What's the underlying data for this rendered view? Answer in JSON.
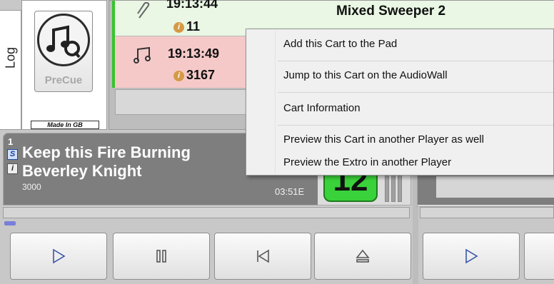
{
  "log_tab": {
    "label": "Log"
  },
  "precue": {
    "label": "PreCue",
    "badge": "Made In GB"
  },
  "log_rows": [
    {
      "time": "19:13:44",
      "info_num": "11",
      "title": "Mixed Sweeper 2"
    },
    {
      "time": "19:13:49",
      "info_num": "3167"
    }
  ],
  "player": {
    "slot": "1",
    "s_button": "S",
    "i_button": "i",
    "title": "Keep this Fire Burning",
    "artist": "Beverley Knight",
    "cart": "3000",
    "duration": "03:51E",
    "counter": "12"
  },
  "context_menu": {
    "items": [
      "Add this Cart to the Pad",
      "Jump to this Cart on the AudioWall",
      "Cart Information",
      "Preview this Cart in another Player as well",
      "Preview the Extro in another Player"
    ]
  },
  "transport": [
    "play-icon",
    "pause-icon",
    "skip-back-icon",
    "eject-icon",
    "play-icon"
  ],
  "colors": {
    "accent_green": "#37c42c",
    "counter_green": "#3ad23a",
    "row_pink": "#f6c9c9",
    "row_green": "#e9f7e4"
  }
}
